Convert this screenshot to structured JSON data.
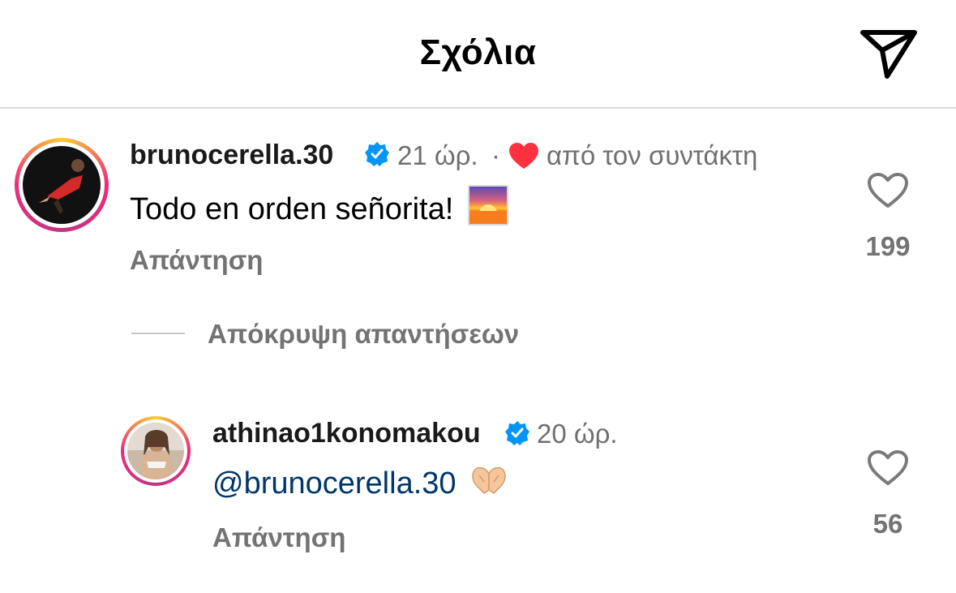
{
  "header": {
    "title": "Σχόλια",
    "share_icon": "paper-plane-icon"
  },
  "comments": [
    {
      "username": "brunocerella.30",
      "verified": true,
      "time": "21 ώρ.",
      "separator": "·",
      "author_liked_label": "από τον συντάκτη",
      "text": "Todo en orden señorita!",
      "emoji": "sunrise-emoji",
      "reply_label": "Απάντηση",
      "like_count": "199"
    }
  ],
  "hide_replies_label": "Απόκρυψη απαντήσεων",
  "replies": [
    {
      "username": "athinao1konomakou",
      "verified": true,
      "time": "20 ώρ.",
      "mention": "@brunocerella.30",
      "emoji": "heart-hands-emoji",
      "reply_label": "Απάντηση",
      "like_count": "56"
    }
  ],
  "colors": {
    "accent_blue": "#0095f6",
    "heart_red": "#ff3040",
    "mention_blue": "#00376b",
    "muted": "#737373"
  }
}
